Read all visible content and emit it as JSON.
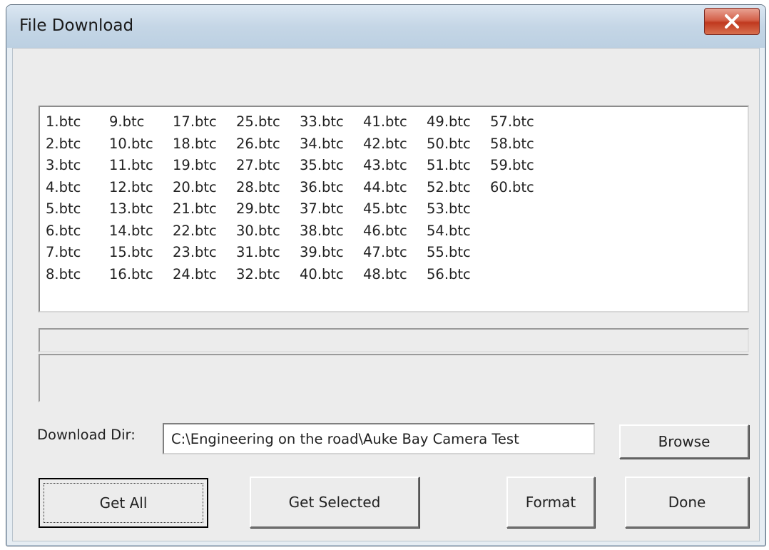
{
  "window": {
    "title": "File Download",
    "close_glyph": "X"
  },
  "file_list": {
    "items": [
      "1.btc",
      "2.btc",
      "3.btc",
      "4.btc",
      "5.btc",
      "6.btc",
      "7.btc",
      "8.btc",
      "9.btc",
      "10.btc",
      "11.btc",
      "12.btc",
      "13.btc",
      "14.btc",
      "15.btc",
      "16.btc",
      "17.btc",
      "18.btc",
      "19.btc",
      "20.btc",
      "21.btc",
      "22.btc",
      "23.btc",
      "24.btc",
      "25.btc",
      "26.btc",
      "27.btc",
      "28.btc",
      "29.btc",
      "30.btc",
      "31.btc",
      "32.btc",
      "33.btc",
      "34.btc",
      "35.btc",
      "36.btc",
      "37.btc",
      "38.btc",
      "39.btc",
      "40.btc",
      "41.btc",
      "42.btc",
      "43.btc",
      "44.btc",
      "45.btc",
      "46.btc",
      "47.btc",
      "48.btc",
      "49.btc",
      "50.btc",
      "51.btc",
      "52.btc",
      "53.btc",
      "54.btc",
      "55.btc",
      "56.btc",
      "57.btc",
      "58.btc",
      "59.btc",
      "60.btc"
    ]
  },
  "download_dir": {
    "label": "Download Dir:",
    "value": "C:\\Engineering on the road\\Auke Bay Camera Test"
  },
  "buttons": {
    "browse": "Browse",
    "get_all": "Get All",
    "get_selected": "Get Selected",
    "format": "Format",
    "done": "Done"
  }
}
